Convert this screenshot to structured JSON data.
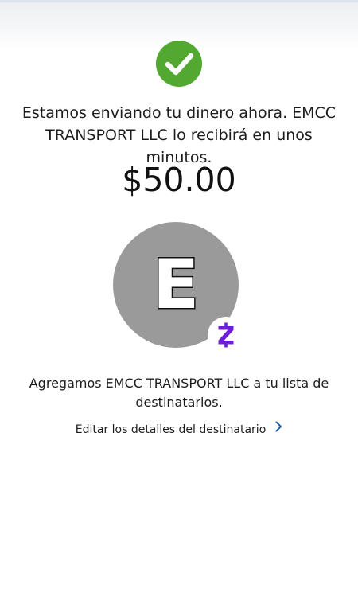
{
  "header": {
    "accent_color": "#dde2ea"
  },
  "status": {
    "icon": "checkmark-circle-icon",
    "color": "#52a830"
  },
  "confirmation": {
    "message": "Estamos enviando tu dinero ahora. EMCC TRANSPORT LLC lo recibirá en unos minutos.",
    "amount": "$50.00"
  },
  "recipient": {
    "avatar_initial": "E",
    "avatar_color": "#9a9a9a",
    "badge_icon": "zelle-icon",
    "badge_color": "#6d1ed4",
    "added_message": "Agregamos EMCC TRANSPORT LLC a tu lista de destinatarios.",
    "edit_link_label": "Editar los detalles del destinatario",
    "edit_link_icon": "chevron-right-icon",
    "link_color": "#1f5f9e"
  }
}
